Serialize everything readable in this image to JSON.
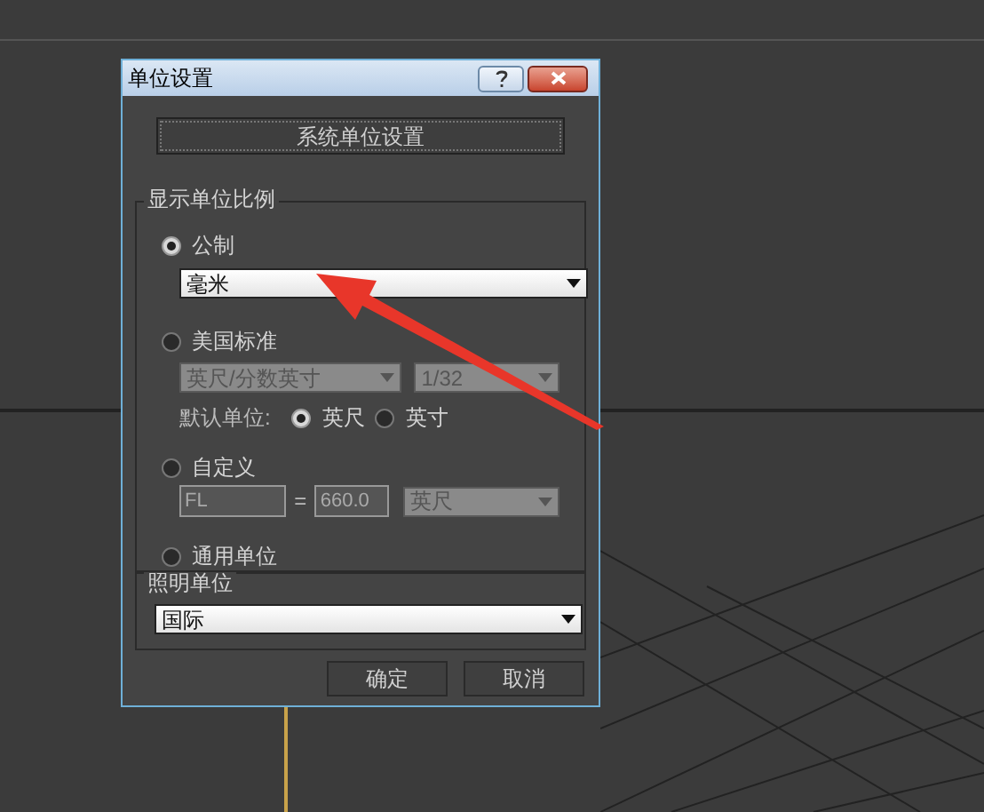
{
  "window": {
    "title": "单位设置"
  },
  "system_units_button": {
    "label": "系统单位设置"
  },
  "display_unit_scale": {
    "title": "显示单位比例",
    "metric": {
      "label": "公制",
      "selected": true,
      "dropdown": {
        "value": "毫米",
        "disabled": false
      }
    },
    "us_standard": {
      "label": "美国标准",
      "selected": false,
      "dropdown": {
        "value": "英尺/分数英寸",
        "disabled": true
      },
      "fraction": {
        "value": "1/32",
        "disabled": true
      },
      "default_unit_label": "默认单位:",
      "default_units": [
        {
          "label": "英尺",
          "selected": true
        },
        {
          "label": "英寸",
          "selected": false
        }
      ]
    },
    "custom": {
      "label": "自定义",
      "selected": false,
      "name_field": {
        "value": "FL",
        "disabled": true
      },
      "equals": "=",
      "value_field": {
        "value": "660.0",
        "disabled": true
      },
      "unit_dropdown": {
        "value": "英尺",
        "disabled": true
      }
    },
    "generic": {
      "label": "通用单位",
      "selected": false
    }
  },
  "lighting_units": {
    "title": "照明单位",
    "dropdown": {
      "value": "国际",
      "disabled": false
    }
  },
  "buttons": [
    {
      "label": "确定"
    },
    {
      "label": "取消"
    }
  ]
}
